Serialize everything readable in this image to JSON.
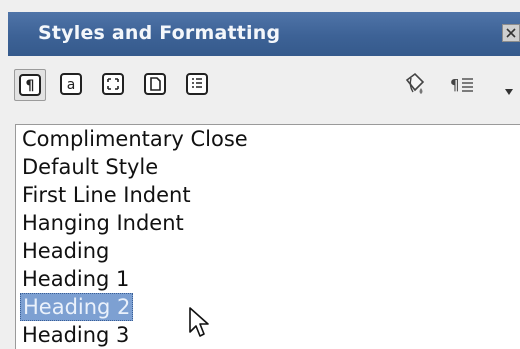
{
  "window": {
    "title": "Styles and Formatting"
  },
  "toolbar": {
    "buttons": [
      {
        "name": "paragraph-styles",
        "glyph": "¶",
        "active": true
      },
      {
        "name": "character-styles",
        "glyph": "a",
        "active": false
      },
      {
        "name": "frame-styles",
        "glyph": "",
        "active": false
      },
      {
        "name": "page-styles",
        "glyph": "D",
        "active": false
      },
      {
        "name": "list-styles",
        "glyph": "",
        "active": false
      }
    ],
    "new_style_glyph": "¶≡",
    "dropdown_glyph": "▾"
  },
  "styles_list": {
    "items": [
      "Complimentary Close",
      "Default Style",
      "First Line Indent",
      "Hanging Indent",
      "Heading",
      "Heading 1",
      "Heading 2",
      "Heading 3"
    ],
    "selected": "Heading 2"
  },
  "colors": {
    "titlebar": "#3d6296",
    "selection": "#7da0d2"
  }
}
